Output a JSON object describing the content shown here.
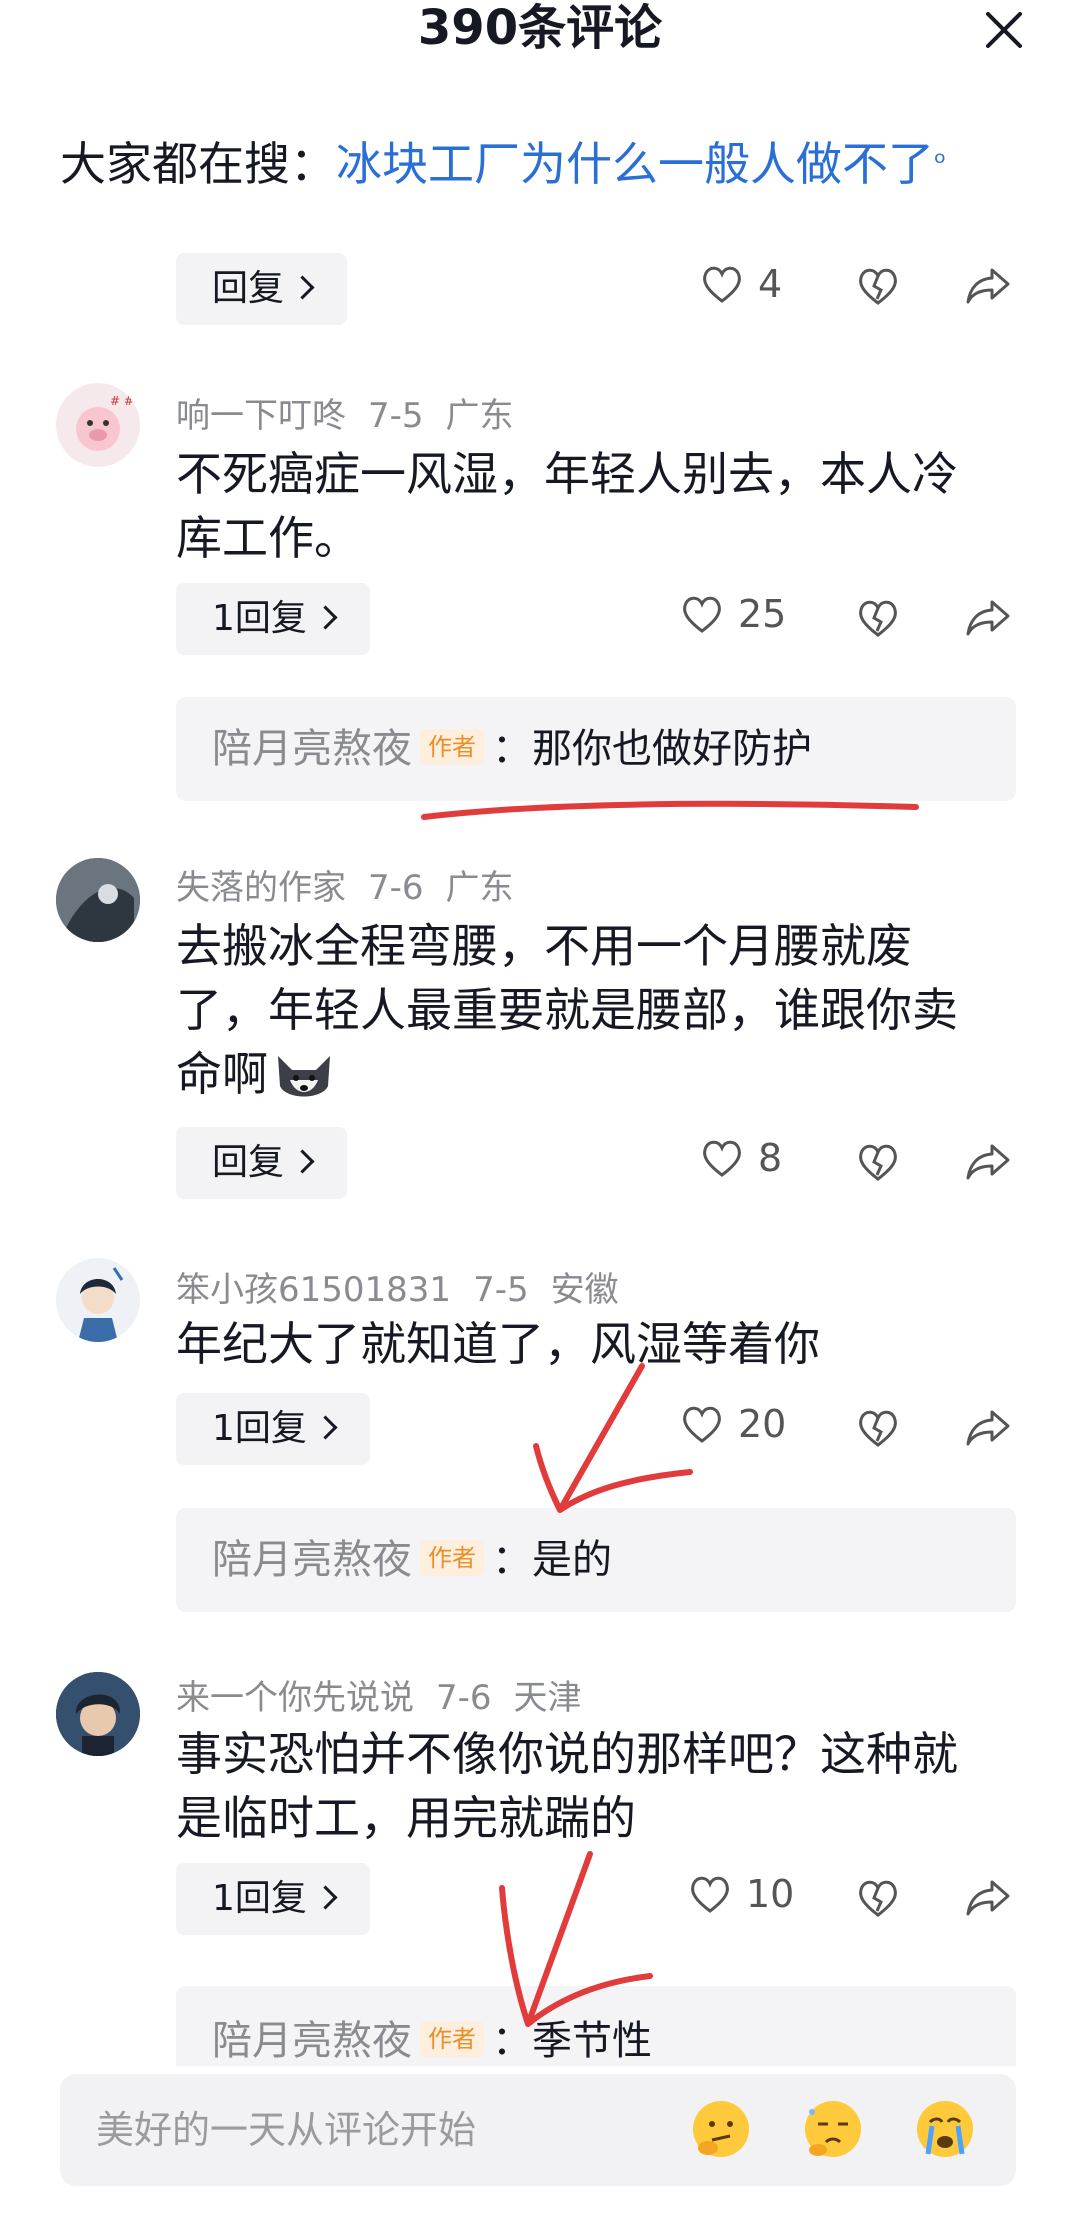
{
  "header": {
    "title": "390条评论"
  },
  "search": {
    "prefix": "大家都在搜：",
    "query": "冰块工厂为什么一般人做不了",
    "q_icon": "ᵒ"
  },
  "comments": [
    {
      "reply_label": "回复",
      "likes": "4"
    },
    {
      "user": "响一下叮咚",
      "date": "7-5",
      "region": "广东",
      "text_line1": "不死癌症一风湿，年轻人别去，本人冷",
      "text_line2": "库工作。",
      "reply_label": "1回复",
      "likes": "25",
      "sub": {
        "user": "陪月亮熬夜",
        "tag": "作者",
        "text": "：那你也做好防护"
      }
    },
    {
      "user": "失落的作家",
      "date": "7-6",
      "region": "广东",
      "text_line1": "去搬冰全程弯腰，不用一个月腰就废",
      "text_line2": "了，年轻人最重要就是腰部，谁跟你卖",
      "text_line3": "命啊",
      "reply_label": "回复",
      "likes": "8"
    },
    {
      "user": "笨小孩61501831",
      "date": "7-5",
      "region": "安徽",
      "text_line1": "年纪大了就知道了，风湿等着你",
      "reply_label": "1回复",
      "likes": "20",
      "sub": {
        "user": "陪月亮熬夜",
        "tag": "作者",
        "text": "：是的"
      }
    },
    {
      "user": "来一个你先说说",
      "date": "7-6",
      "region": "天津",
      "text_line1": "事实恐怕并不像你说的那样吧？这种就",
      "text_line2": "是临时工，用完就踹的",
      "reply_label": "1回复",
      "likes": "10",
      "sub": {
        "user": "陪月亮熬夜",
        "tag": "作者",
        "text": "：季节性"
      }
    }
  ],
  "input": {
    "placeholder": "美好的一天从评论开始"
  },
  "colors": {
    "accent_link": "#2a6fd6",
    "author_tag": "#e8902a",
    "annotation_red": "#e23b3b"
  },
  "icons": [
    "close-icon",
    "search-icon",
    "heart-icon",
    "broken-heart-icon",
    "share-icon",
    "emoji-thinking-icon",
    "emoji-squint-icon",
    "emoji-crying-icon"
  ]
}
